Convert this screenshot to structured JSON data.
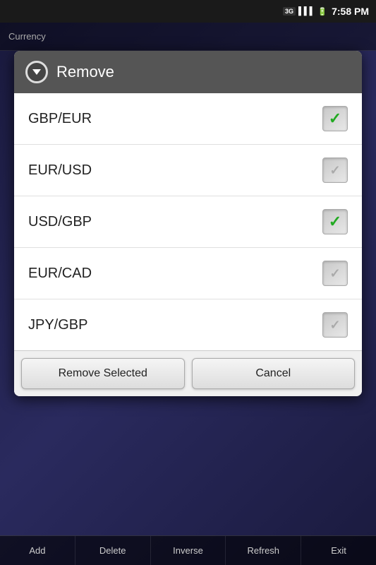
{
  "statusBar": {
    "time": "7:58 PM",
    "signal": "3G"
  },
  "appTopbar": {
    "title": "Currency"
  },
  "dialog": {
    "header": {
      "title": "Remove",
      "iconSymbol": "▼"
    },
    "currencies": [
      {
        "id": "gbp-eur",
        "label": "GBP/EUR",
        "checked": true
      },
      {
        "id": "eur-usd",
        "label": "EUR/USD",
        "checked": false
      },
      {
        "id": "usd-gbp",
        "label": "USD/GBP",
        "checked": true
      },
      {
        "id": "eur-cad",
        "label": "EUR/CAD",
        "checked": false
      },
      {
        "id": "jpy-gbp",
        "label": "JPY/GBP",
        "checked": false
      }
    ],
    "buttons": {
      "removeSelected": "Remove Selected",
      "cancel": "Cancel"
    }
  },
  "bottomNav": {
    "items": [
      "Add",
      "Delete",
      "Inverse",
      "Refresh",
      "Exit"
    ]
  }
}
